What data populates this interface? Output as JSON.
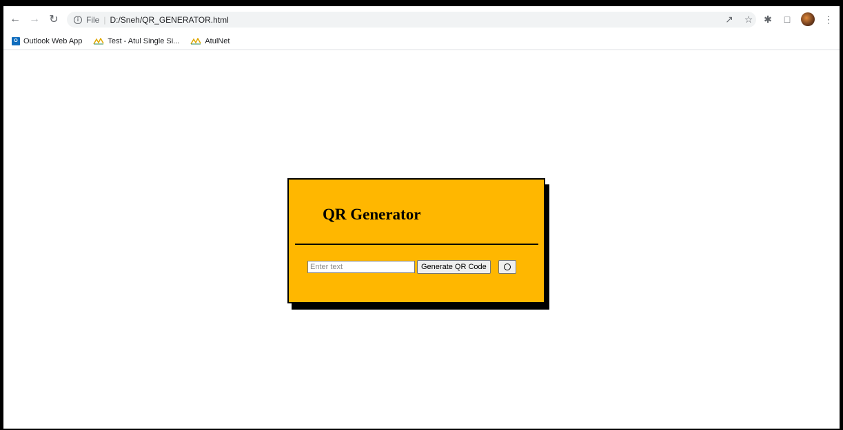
{
  "browser": {
    "scheme_label": "File",
    "url": "D:/Sneh/QR_GENERATOR.html",
    "bookmarks": [
      {
        "label": "Outlook Web App",
        "icon": "outlook-icon"
      },
      {
        "label": "Test - Atul Single Si...",
        "icon": "atul-icon"
      },
      {
        "label": "AtulNet",
        "icon": "atul-icon"
      }
    ]
  },
  "card": {
    "title": "QR Generator",
    "input_placeholder": "Enter text",
    "generate_label": "Generate QR Code"
  },
  "colors": {
    "card_bg": "#ffb700",
    "shadow": "#000000"
  }
}
